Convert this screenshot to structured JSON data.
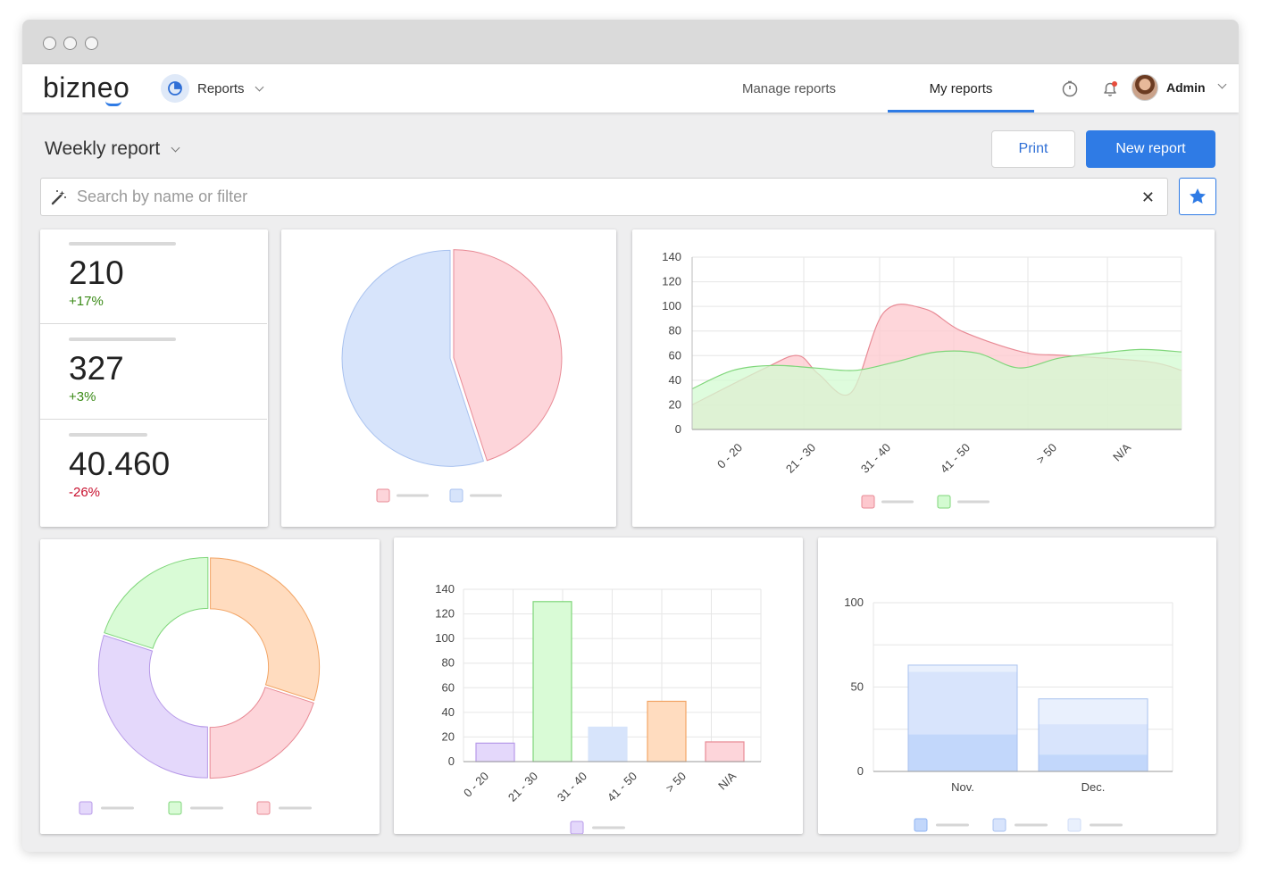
{
  "header": {
    "logo": "bizneo",
    "module_label": "Reports",
    "tabs": [
      {
        "label": "Manage reports",
        "active": false
      },
      {
        "label": "My reports",
        "active": true
      }
    ],
    "user_name": "Admin",
    "notification_dot_color": "#e74c3c"
  },
  "toolbar": {
    "page_title": "Weekly report",
    "print_label": "Print",
    "new_report_label": "New report",
    "accent_color": "#2f7be5"
  },
  "search": {
    "placeholder": "Search by name or filter",
    "value": "",
    "clear_symbol": "✕"
  },
  "kpis": [
    {
      "value": "210",
      "change": "+17%",
      "trend": "up"
    },
    {
      "value": "327",
      "change": "+3%",
      "trend": "up"
    },
    {
      "value": "40.460",
      "change": "-26%",
      "trend": "down"
    }
  ],
  "chart_data": [
    {
      "type": "pie",
      "title": "",
      "slices": [
        {
          "value": 45,
          "color": "#fdd5da",
          "stroke": "#e88a95"
        },
        {
          "value": 55,
          "color": "#d7e4fb",
          "stroke": "#a9c2ef"
        }
      ],
      "legend_placement": "bottom"
    },
    {
      "type": "area",
      "title": "",
      "categories": [
        "0 - 20",
        "21 - 30",
        "31 - 40",
        "41 - 50",
        "> 50",
        "N/A"
      ],
      "ylim": [
        0,
        140
      ],
      "yticks": [
        0,
        20,
        40,
        60,
        80,
        100,
        120,
        140
      ],
      "grid": true,
      "series": [
        {
          "x": [
            0,
            0.9,
            1.3,
            1.55,
            1.95,
            2.35,
            2.85,
            3.3,
            4.05,
            4.6,
            5.6,
            6
          ],
          "values": [
            20,
            50,
            60,
            45,
            30,
            95,
            98,
            80,
            63,
            60,
            55,
            48
          ],
          "color": "#fdc8ce",
          "stroke": "#e88a95"
        },
        {
          "x": [
            0,
            0.5,
            1,
            1.5,
            2,
            2.5,
            3,
            3.5,
            4,
            4.5,
            5,
            5.5,
            6
          ],
          "values": [
            33,
            48,
            52,
            50,
            48,
            55,
            63,
            62,
            50,
            58,
            62,
            65,
            63
          ],
          "color": "#d3fbd1",
          "stroke": "#7fd67a"
        }
      ],
      "legend_placement": "bottom"
    },
    {
      "type": "pie",
      "title": "",
      "slices": [
        {
          "value": 30,
          "color": "#ffdcbf",
          "stroke": "#f2a566"
        },
        {
          "value": 20,
          "color": "#fdd5da",
          "stroke": "#e88a95"
        },
        {
          "value": 30,
          "color": "#e4d8fb",
          "stroke": "#b79ae8"
        },
        {
          "value": 20,
          "color": "#d9fbd6",
          "stroke": "#7fd67a"
        }
      ],
      "donut": true,
      "legend_placement": "bottom",
      "legend_colors": [
        "#e4d8fb",
        "#d9fbd6",
        "#fdd5da"
      ]
    },
    {
      "type": "bar",
      "title": "",
      "categories": [
        "0 - 20",
        "21 - 30",
        "31 - 40",
        "41 - 50",
        "> 50",
        "N/A"
      ],
      "values": [
        15,
        130,
        28,
        49,
        16
      ],
      "colors": [
        "#e4d8fb",
        "#d9fbd6",
        "#d7e4fb",
        "#ffdcbf",
        "#fdd5da"
      ],
      "strokes": [
        "#b79ae8",
        "#7fd67a",
        "#d7e4fb",
        "#f2a566",
        "#e88a95"
      ],
      "ylim": [
        0,
        140
      ],
      "yticks": [
        0,
        20,
        40,
        60,
        80,
        100,
        120,
        140
      ],
      "grid": true,
      "legend_placement": "bottom"
    },
    {
      "type": "bar",
      "title": "",
      "stacked": true,
      "categories": [
        "Nov.",
        "Dec."
      ],
      "series": [
        {
          "values": [
            22,
            10
          ],
          "color": "#c2d7fb"
        },
        {
          "values": [
            37,
            18
          ],
          "color": "#d8e4fc"
        },
        {
          "values": [
            4,
            15
          ],
          "color": "#e9f0fd"
        }
      ],
      "ylim": [
        0,
        100
      ],
      "yticks": [
        0,
        50,
        100
      ],
      "grid": true,
      "legend_placement": "bottom"
    }
  ]
}
